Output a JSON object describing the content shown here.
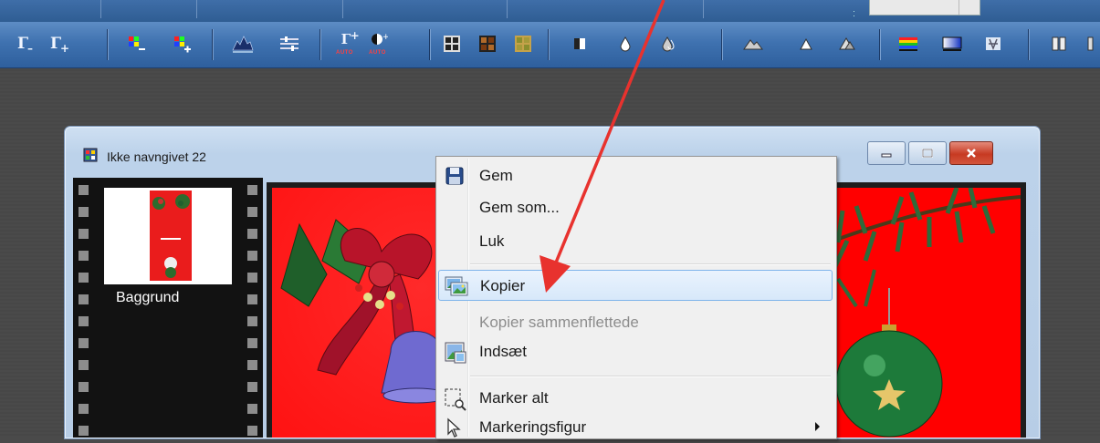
{
  "document_window": {
    "title": "Ikke navngivet 22",
    "layer_label": "Baggrund"
  },
  "context_menu": {
    "items": [
      {
        "label": "Gem",
        "icon": "save-icon",
        "enabled": true
      },
      {
        "label": "Gem som...",
        "icon": "",
        "enabled": true
      },
      {
        "label": "Luk",
        "icon": "",
        "enabled": true
      },
      {
        "label": "Kopier",
        "icon": "copy-image-icon",
        "enabled": true,
        "highlighted": true
      },
      {
        "label": "Kopier sammenflettede",
        "icon": "",
        "enabled": false
      },
      {
        "label": "Indsæt",
        "icon": "paste-icon",
        "enabled": true
      },
      {
        "label": "Marker alt",
        "icon": "select-all-icon",
        "enabled": true
      },
      {
        "label": "Markeringsfigur",
        "icon": "selection-cursor-icon",
        "enabled": true,
        "submenu": true
      }
    ]
  },
  "toolbar": {
    "buttons": [
      "gamma-decrease-icon",
      "gamma-increase-icon",
      "color-decrease-icon",
      "color-increase-icon",
      "histogram-icon",
      "levels-icon",
      "auto-gamma-icon",
      "auto-contrast-icon",
      "dark-grid-icon",
      "brown-grid-icon",
      "olive-grid-icon",
      "contrast-icon",
      "drop-icon",
      "drops-icon",
      "mountain-icon",
      "small-mountain-icon",
      "mountains-icon",
      "rainbow-icon",
      "gradient-icon",
      "sparkle-icon",
      "columns-icon"
    ],
    "auto_text": "AUTO"
  },
  "colors": {
    "toolbar_blue": "#3f72b0",
    "menu_highlight": "#d7e8fa",
    "canvas_red": "#ff0000",
    "annotation_arrow": "#e8322e"
  }
}
